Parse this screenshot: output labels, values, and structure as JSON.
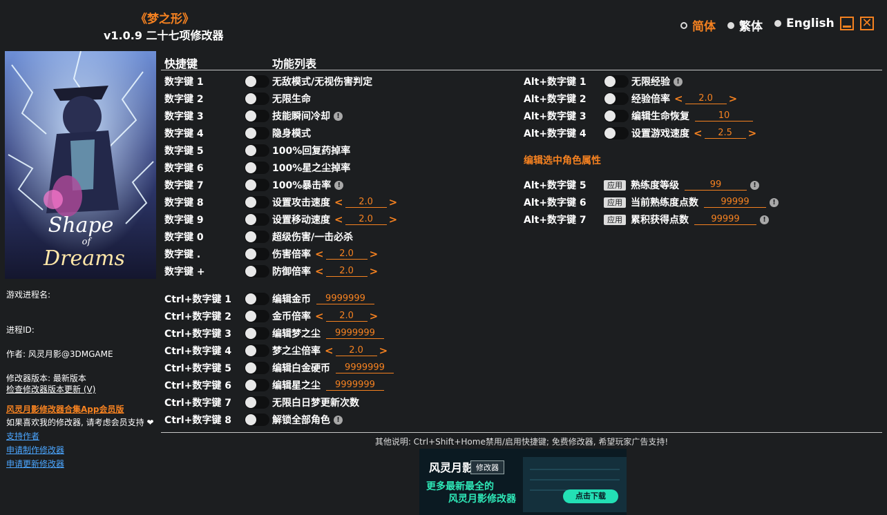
{
  "header": {
    "game_title": "《梦之形》",
    "version_title": "v1.0.9 二十七项修改器"
  },
  "languages": [
    {
      "label": "简体",
      "active": true
    },
    {
      "label": "繁体",
      "active": false
    },
    {
      "label": "English",
      "active": false
    }
  ],
  "window_controls": {
    "close_glyph": "✕"
  },
  "cover": {
    "logo_line1": "Shape",
    "logo_line2": "of",
    "logo_line3": "Dreams"
  },
  "sidebar": {
    "process_name_label": "游戏进程名:",
    "process_id_label": "进程ID:",
    "author": "作者: 风灵月影@3DMGAME",
    "trainer_version": "修改器版本: 最新版本",
    "check_update": "检查修改器版本更新 (V)",
    "app_link": "风灵月影修改器合集App会员版",
    "support_text": "如果喜欢我的修改器, 请考虑会员支持",
    "support_author": "支持作者",
    "request_make": "申请制作修改器",
    "request_update": "申请更新修改器"
  },
  "columns": {
    "hotkey": "快捷键",
    "features": "功能列表"
  },
  "left_rows": [
    {
      "key": "数字键 1",
      "label": "无敌模式/无视伤害判定"
    },
    {
      "key": "数字键 2",
      "label": "无限生命"
    },
    {
      "key": "数字键 3",
      "label": "技能瞬间冷却",
      "warn": "!"
    },
    {
      "key": "数字键 4",
      "label": "隐身模式"
    },
    {
      "key": "数字键 5",
      "label": "100%回复药掉率"
    },
    {
      "key": "数字键 6",
      "label": "100%星之尘掉率"
    },
    {
      "key": "数字键 7",
      "label": "100%暴击率",
      "warn": "!"
    },
    {
      "key": "数字键 8",
      "label": "设置攻击速度",
      "stepper": "2.0"
    },
    {
      "key": "数字键 9",
      "label": "设置移动速度",
      "stepper": "2.0"
    },
    {
      "key": "数字键 0",
      "label": "超级伤害/一击必杀"
    },
    {
      "key": "数字键 .",
      "label": "伤害倍率",
      "stepper": "2.0"
    },
    {
      "key": "数字键 +",
      "label": "防御倍率",
      "stepper": "2.0"
    }
  ],
  "ctrl_rows": [
    {
      "key": "Ctrl+数字键 1",
      "label": "编辑金币",
      "input": "9999999"
    },
    {
      "key": "Ctrl+数字键 2",
      "label": "金币倍率",
      "stepper": "2.0"
    },
    {
      "key": "Ctrl+数字键 3",
      "label": "编辑梦之尘",
      "input": "9999999"
    },
    {
      "key": "Ctrl+数字键 4",
      "label": "梦之尘倍率",
      "stepper": "2.0"
    },
    {
      "key": "Ctrl+数字键 5",
      "label": "编辑白金硬币",
      "input": "9999999"
    },
    {
      "key": "Ctrl+数字键 6",
      "label": "编辑星之尘",
      "input": "9999999"
    },
    {
      "key": "Ctrl+数字键 7",
      "label": "无限白日梦更新次数"
    },
    {
      "key": "Ctrl+数字键 8",
      "label": "解锁全部角色",
      "warn": "!"
    }
  ],
  "alt_rows": [
    {
      "key": "Alt+数字键 1",
      "label": "无限经验",
      "warn": "!"
    },
    {
      "key": "Alt+数字键 2",
      "label": "经验倍率",
      "stepper": "2.0"
    },
    {
      "key": "Alt+数字键 3",
      "label": "编辑生命恢复",
      "input": "10"
    },
    {
      "key": "Alt+数字键 4",
      "label": "设置游戏速度",
      "stepper": "2.5"
    }
  ],
  "section_title": "编辑选中角色属性",
  "apply_label": "应用",
  "alt_apply_rows": [
    {
      "key": "Alt+数字键 5",
      "label": "熟练度等级",
      "input": "99",
      "warn": "!"
    },
    {
      "key": "Alt+数字键 6",
      "label": "当前熟练度点数",
      "input": "99999",
      "warn": "!"
    },
    {
      "key": "Alt+数字键 7",
      "label": "累积获得点数",
      "input": "99999",
      "warn": "!"
    }
  ],
  "footer_note": "其他说明: Ctrl+Shift+Home禁用/启用快捷键; 免费修改器, 希望玩家广告支持!",
  "ad": {
    "brand": "风灵月影",
    "tag": "修改器",
    "line1": "更多最新最全的",
    "line2": "风灵月影修改器",
    "download": "点击下载"
  },
  "colors": {
    "accent": "#f68220",
    "link": "#4ba6ff",
    "background": "#1c1e20"
  }
}
